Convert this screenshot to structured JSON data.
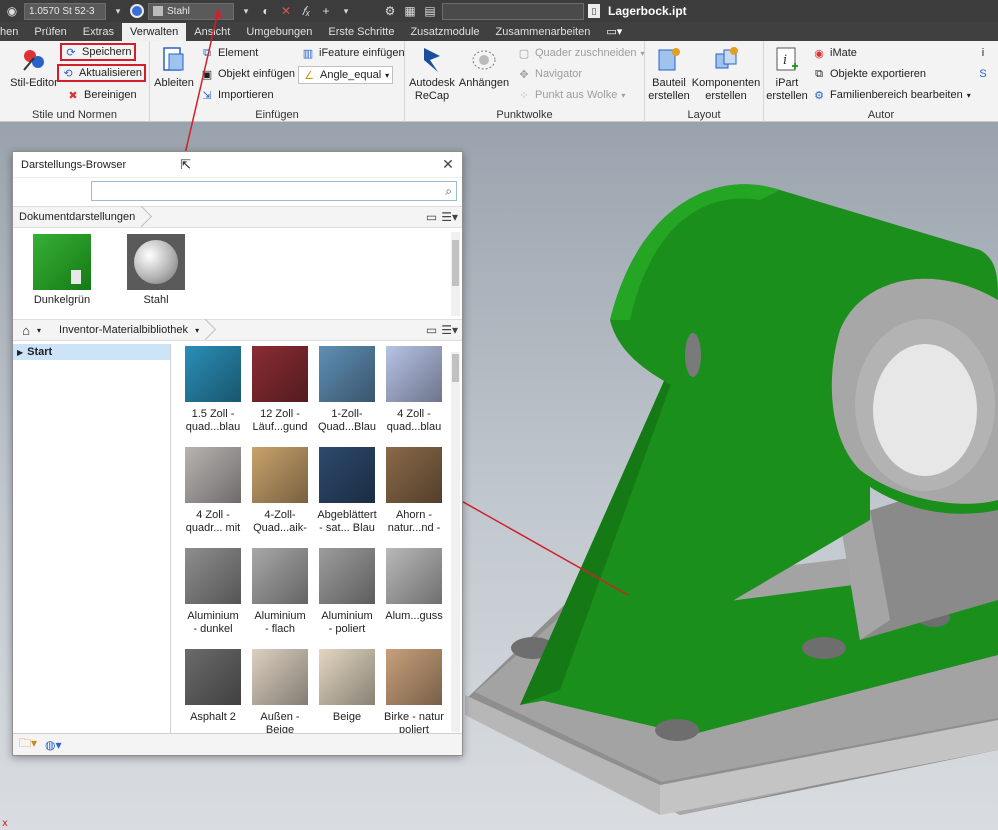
{
  "qat": {
    "material": "1.0570 St 52-3",
    "appearance": "Stahl",
    "file_title": "Lagerbock.ipt"
  },
  "tabs": [
    "hen",
    "Prüfen",
    "Extras",
    "Verwalten",
    "Ansicht",
    "Umgebungen",
    "Erste Schritte",
    "Zusatzmodule",
    "Zusammenarbeiten"
  ],
  "ribbon": {
    "stile": {
      "title": "Stile und Normen",
      "stil_editor": "Stil-Editor",
      "speichern": "Speichern",
      "aktualisieren": "Aktualisieren",
      "bereinigen": "Bereinigen"
    },
    "einfuegen": {
      "title": "Einfügen",
      "ableiten": "Ableiten",
      "element": "Element",
      "objekt_einfuegen": "Objekt einfügen",
      "importieren": "Importieren",
      "ifeature_einfuegen": "iFeature einfügen",
      "angle_equal": "Angle_equal"
    },
    "punktwolke": {
      "title": "Punktwolke",
      "autodesk_recap": "Autodesk\nReCap",
      "anhaengen": "Anhängen",
      "quader": "Quader zuschneiden",
      "navigator": "Navigator",
      "punkt_aus_wolke": "Punkt aus Wolke"
    },
    "layout": {
      "title": "Layout",
      "bauteil": "Bauteil\nerstellen",
      "komponenten": "Komponenten\nerstellen"
    },
    "autor": {
      "title": "Autor",
      "ipart": "iPart\nerstellen",
      "imate": "iMate",
      "objekte_exportieren": "Objekte exportieren",
      "familienbereich": "Familienbereich bearbeiten"
    }
  },
  "browser": {
    "title": "Darstellungs-Browser",
    "search_placeholder": "",
    "doc_crumb": "Dokumentdarstellungen",
    "doc_items": [
      {
        "label": "Dunkelgrün",
        "color": "#1e8c1e"
      },
      {
        "label": "Stahl",
        "color": "#c8c8c8"
      }
    ],
    "lib_crumb": "Inventor-Materialbibliothek",
    "tree_start": "Start",
    "materials": [
      {
        "l1": "1.5 Zoll -",
        "l2": "quad...blau",
        "color": "#2a8fb8"
      },
      {
        "l1": "12 Zoll -",
        "l2": "Läuf...gund",
        "color": "#8a2d34"
      },
      {
        "l1": "1-Zoll-",
        "l2": "Quad...Blau",
        "color": "#5f8fb5"
      },
      {
        "l1": "4 Zoll -",
        "l2": "quad...blau",
        "color": "#b7c3e6"
      },
      {
        "l1": "4 Zoll -",
        "l2": "quadr... mit",
        "color": "#b8b4b2"
      },
      {
        "l1": "4-Zoll-",
        "l2": "Quad...aik-",
        "color": "#c9a26c"
      },
      {
        "l1": "Abgeblättert",
        "l2": "- sat... Blau",
        "color": "#2d4a6e"
      },
      {
        "l1": "Ahorn -",
        "l2": "natur...nd -",
        "color": "#8a6a48"
      },
      {
        "l1": "Aluminium",
        "l2": "- dunkel",
        "color": "#8e8e8e"
      },
      {
        "l1": "Aluminium",
        "l2": "- flach",
        "color": "#a8a8a8"
      },
      {
        "l1": "Aluminium",
        "l2": "- poliert",
        "color": "#9c9c9c"
      },
      {
        "l1": "Alum...guss",
        "l2": "",
        "color": "#b9b9b9"
      },
      {
        "l1": "Asphalt 2",
        "l2": "",
        "color": "#6b6b6b"
      },
      {
        "l1": "Außen -",
        "l2": "Beige",
        "color": "#dcd0c0"
      },
      {
        "l1": "Beige",
        "l2": "",
        "color": "#e3d7c2"
      },
      {
        "l1": "Birke - natur",
        "l2": "poliert",
        "color": "#c8a07a"
      }
    ]
  },
  "colors": {
    "part_green": "#1b8f1b",
    "part_grey": "#9a9a9a",
    "annotation_red": "#d0202a"
  }
}
